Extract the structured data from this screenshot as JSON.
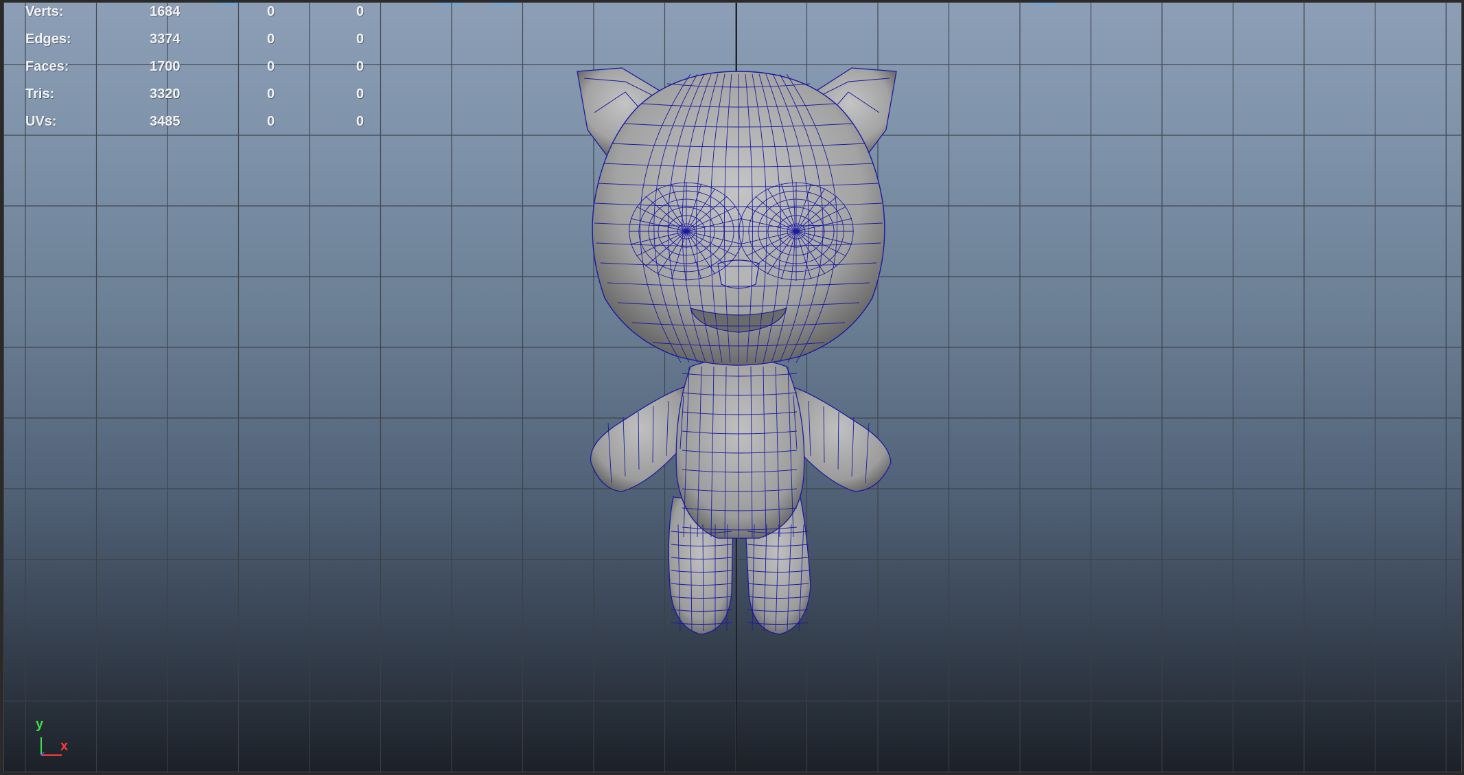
{
  "hud": {
    "rows": [
      {
        "label": "Verts:",
        "v1": "1684",
        "v2": "0",
        "v3": "0"
      },
      {
        "label": "Edges:",
        "v1": "3374",
        "v2": "0",
        "v3": "0"
      },
      {
        "label": "Faces:",
        "v1": "1700",
        "v2": "0",
        "v3": "0"
      },
      {
        "label": "Tris:",
        "v1": "3320",
        "v2": "0",
        "v3": "0"
      },
      {
        "label": "UVs:",
        "v1": "3485",
        "v2": "0",
        "v3": "0"
      }
    ]
  },
  "axis": {
    "y_label": "y",
    "x_label": "x"
  },
  "colors": {
    "wireframe": "#1a1aa0",
    "mesh_fill": "#a8a8a8",
    "grid": "#3c4048",
    "axis_y": "#3fe03f",
    "axis_x": "#ff3a3a",
    "axis_z": "#3a5aff"
  },
  "icons": [
    "axis-gizmo-icon"
  ]
}
